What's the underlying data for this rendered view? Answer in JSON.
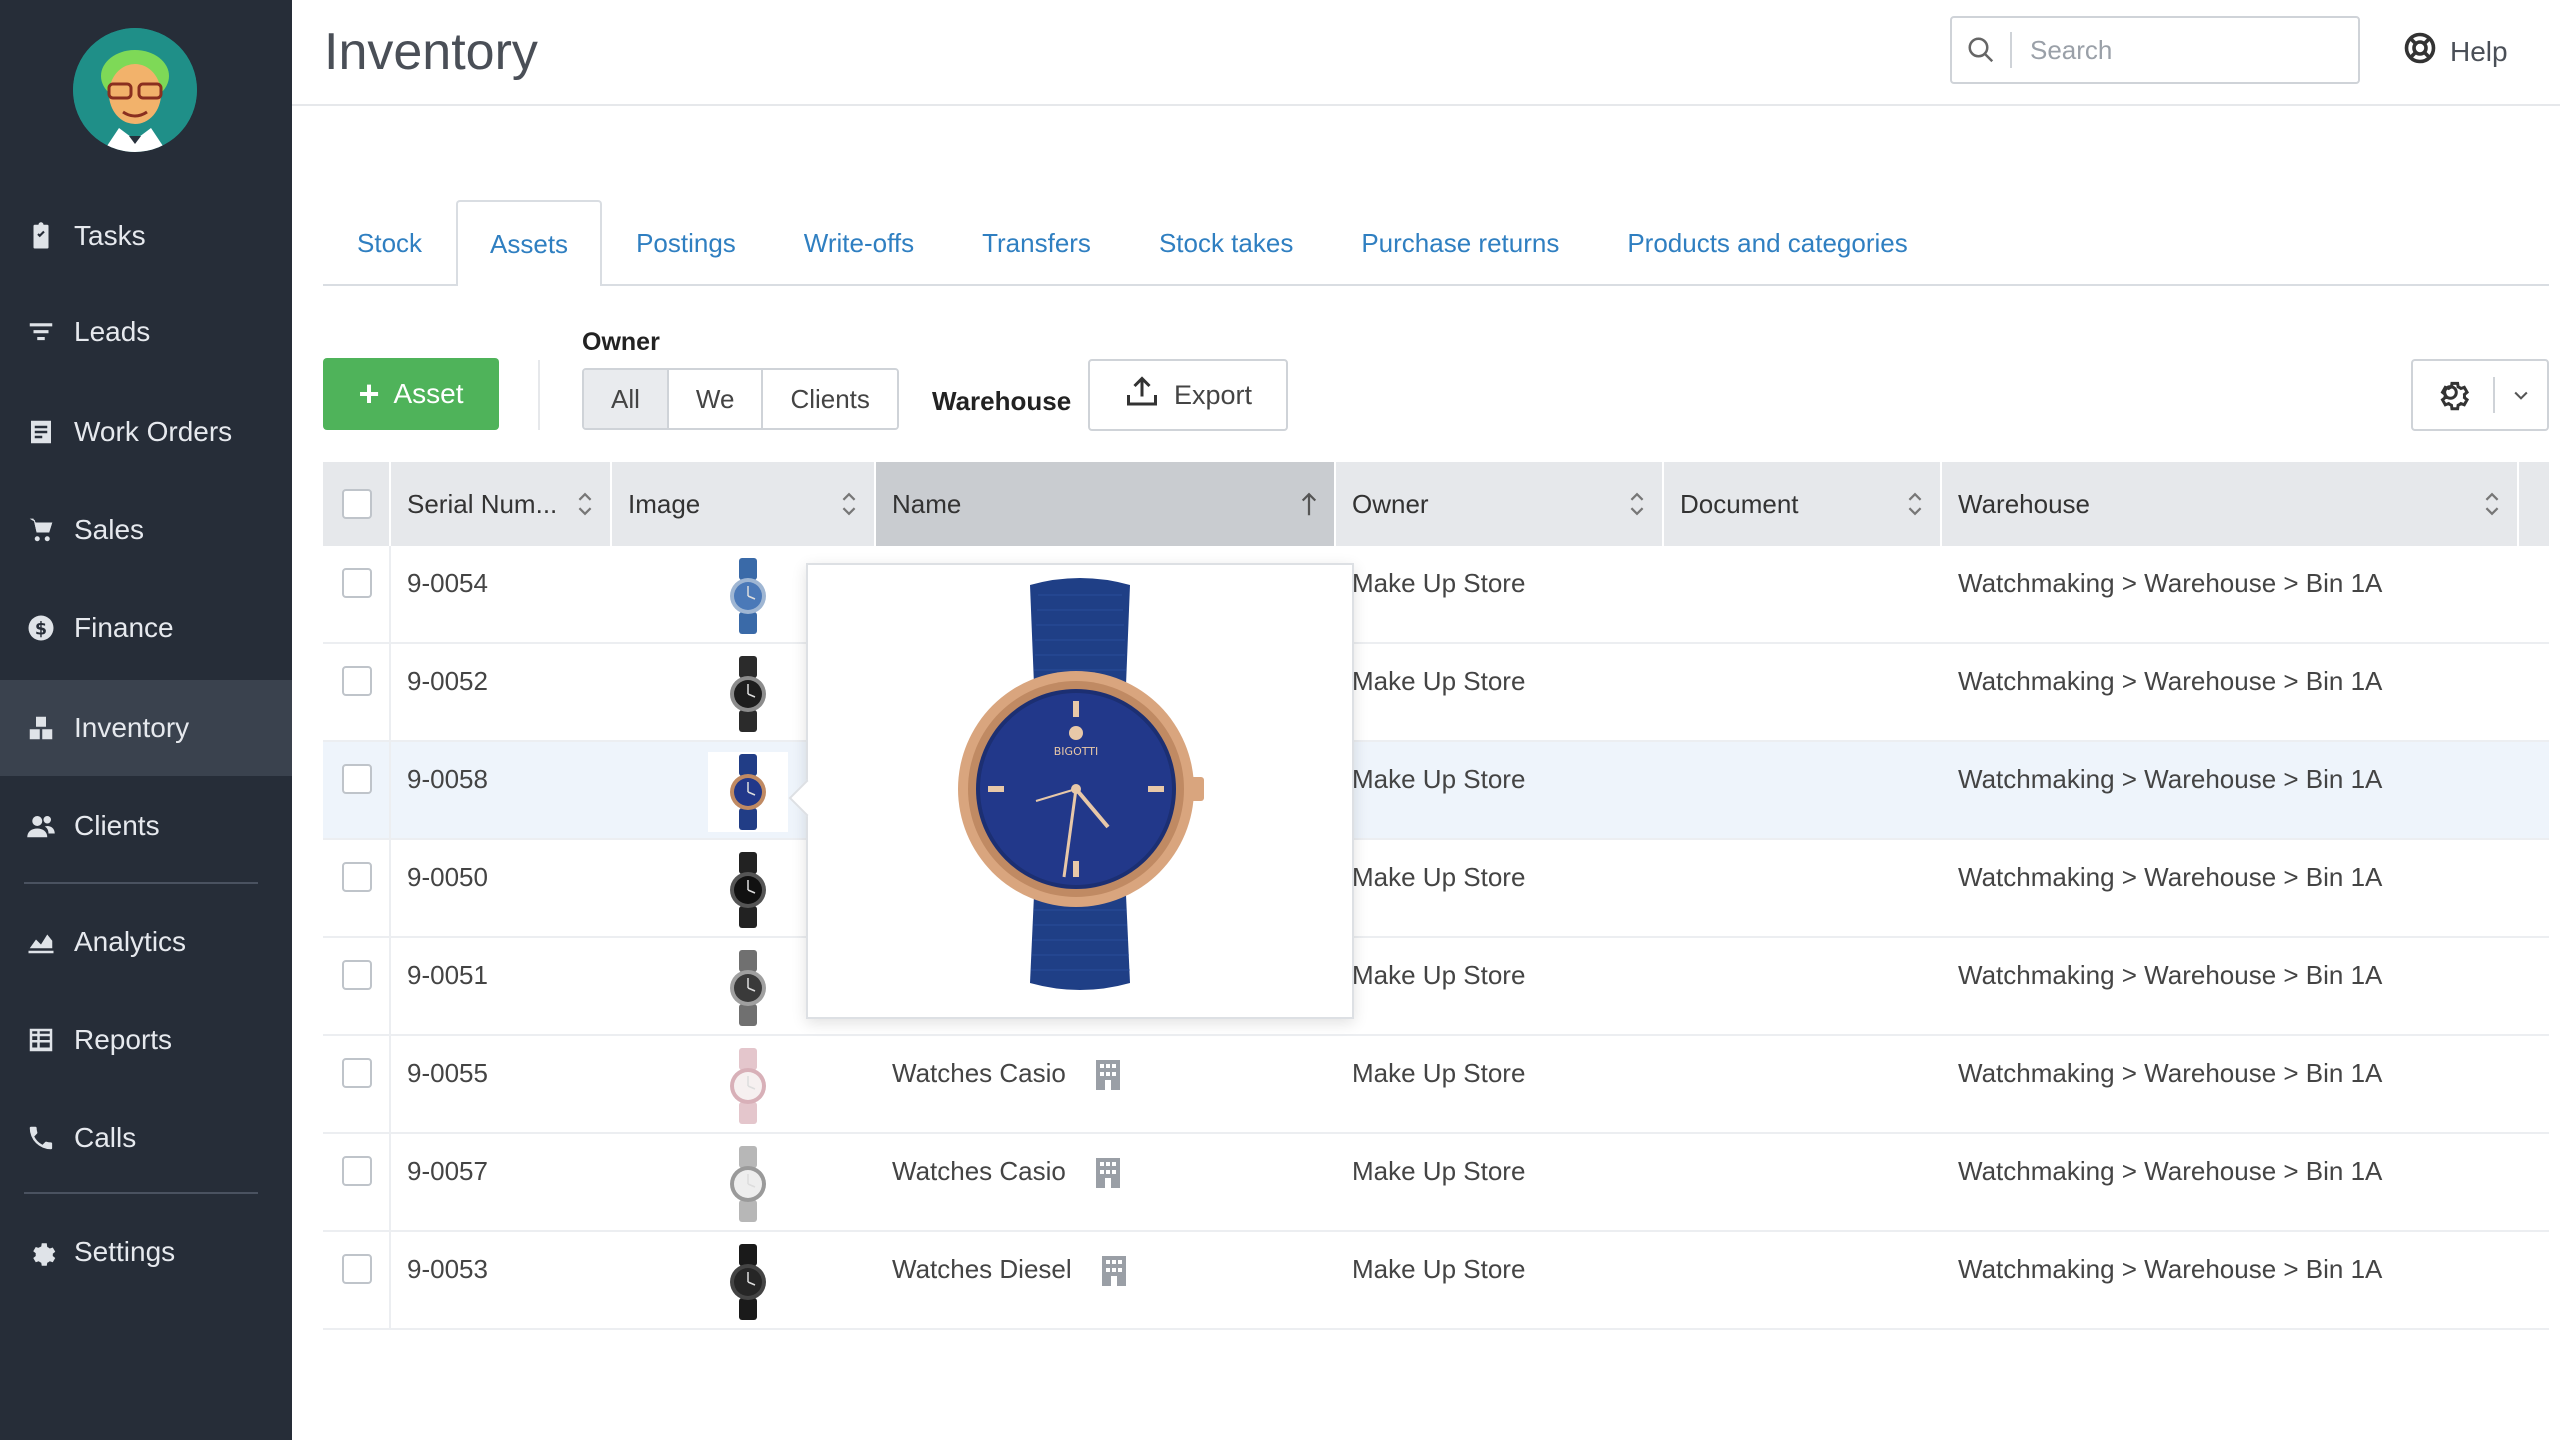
{
  "sidebar": {
    "items": [
      {
        "label": "Tasks",
        "icon": "clipboard-icon"
      },
      {
        "label": "Leads",
        "icon": "funnel-icon"
      },
      {
        "label": "Work Orders",
        "icon": "work-order-icon"
      },
      {
        "label": "Sales",
        "icon": "cart-icon"
      },
      {
        "label": "Finance",
        "icon": "dollar-icon"
      },
      {
        "label": "Inventory",
        "icon": "boxes-icon",
        "active": true
      },
      {
        "label": "Clients",
        "icon": "people-icon"
      },
      {
        "label": "Analytics",
        "icon": "chart-icon"
      },
      {
        "label": "Reports",
        "icon": "reports-icon"
      },
      {
        "label": "Calls",
        "icon": "phone-icon"
      },
      {
        "label": "Settings",
        "icon": "gear-icon"
      }
    ]
  },
  "header": {
    "title": "Inventory",
    "search_placeholder": "Search",
    "help_label": "Help"
  },
  "tabs": [
    {
      "label": "Stock"
    },
    {
      "label": "Assets",
      "active": true
    },
    {
      "label": "Postings"
    },
    {
      "label": "Write-offs"
    },
    {
      "label": "Transfers"
    },
    {
      "label": "Stock takes"
    },
    {
      "label": "Purchase returns"
    },
    {
      "label": "Products and categories"
    }
  ],
  "toolbar": {
    "add_label": "Asset",
    "owner_label": "Owner",
    "owner_options": [
      "All",
      "We",
      "Clients"
    ],
    "owner_selected": "All",
    "warehouse_label": "Warehouse",
    "export_label": "Export"
  },
  "table": {
    "columns": [
      "Serial Num...",
      "Image",
      "Name",
      "Owner",
      "Document",
      "Warehouse"
    ],
    "sorted_column": "Name",
    "rows": [
      {
        "serial": "9-0054",
        "name": "",
        "owner": "Make Up Store",
        "document": "",
        "warehouse": "Watchmaking > Warehouse > Bin 1A",
        "watch": "blue"
      },
      {
        "serial": "9-0052",
        "name": "",
        "owner": "Make Up Store",
        "document": "",
        "warehouse": "Watchmaking > Warehouse > Bin 1A",
        "watch": "black-steel"
      },
      {
        "serial": "9-0058",
        "name": "",
        "owner": "Make Up Store",
        "document": "",
        "warehouse": "Watchmaking > Warehouse > Bin 1A",
        "watch": "navy",
        "highlighted": true
      },
      {
        "serial": "9-0050",
        "name": "",
        "owner": "Make Up Store",
        "document": "",
        "warehouse": "Watchmaking > Warehouse > Bin 1A",
        "watch": "black"
      },
      {
        "serial": "9-0051",
        "name": "",
        "owner": "Make Up Store",
        "document": "",
        "warehouse": "Watchmaking > Warehouse > Bin 1A",
        "watch": "steel"
      },
      {
        "serial": "9-0055",
        "name": "Watches Casio",
        "owner": "Make Up Store",
        "document": "",
        "warehouse": "Watchmaking > Warehouse > Bin 1A",
        "watch": "pink"
      },
      {
        "serial": "9-0057",
        "name": "Watches Casio",
        "owner": "Make Up Store",
        "document": "",
        "warehouse": "Watchmaking > Warehouse > Bin 1A",
        "watch": "silver"
      },
      {
        "serial": "9-0053",
        "name": "Watches Diesel",
        "owner": "Make Up Store",
        "document": "",
        "warehouse": "Watchmaking > Warehouse > Bin 1A",
        "watch": "dark"
      }
    ]
  },
  "preview": {
    "brand_text": "BIGOTTI"
  },
  "colors": {
    "sidebar_bg": "#262d38",
    "accent_green": "#4fb35a",
    "link_blue": "#2f7fc1"
  }
}
